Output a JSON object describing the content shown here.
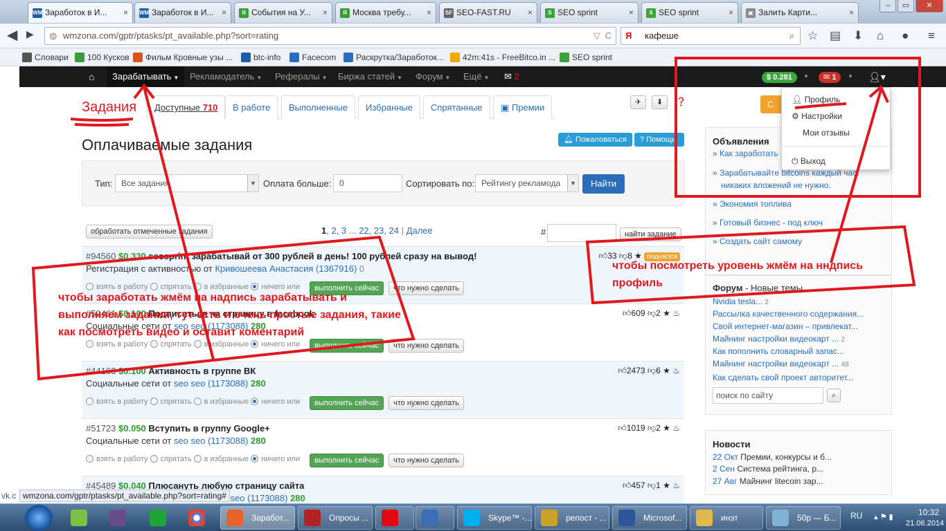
{
  "browser": {
    "tabs": [
      {
        "label": "Заработок в И...",
        "icon_color": "#1f5da6",
        "icon_text": "WM"
      },
      {
        "label": "Заработок в И...",
        "icon_color": "#1f5da6",
        "icon_text": "WM"
      },
      {
        "label": "События на У...",
        "icon_color": "#3a9b3a",
        "icon_text": "ЯЛ"
      },
      {
        "label": "Москва требу...",
        "icon_color": "#3a9b3a",
        "icon_text": "ЯЛ"
      },
      {
        "label": "SEO-FAST.RU",
        "icon_color": "#666",
        "icon_text": "SF"
      },
      {
        "label": "SEO sprint",
        "icon_color": "#3aa33a",
        "icon_text": "S"
      },
      {
        "label": "SEO sprint",
        "icon_color": "#3aa33a",
        "icon_text": "S"
      },
      {
        "label": "Залить Карти...",
        "icon_color": "#8a8a8a",
        "icon_text": "▣"
      }
    ],
    "tab_close": "×",
    "url": "wmzona.com/gptr/ptasks/pt_available.php?sort=rating",
    "search_value": "кафеше",
    "search_engine_icon": "Я",
    "bookmarks": [
      {
        "label": "Словари",
        "icon_color": "#555"
      },
      {
        "label": "100 Кусков",
        "icon_color": "#3a9b3a"
      },
      {
        "label": "Фильм Кровные узы ...",
        "icon_color": "#d9541c"
      },
      {
        "label": "btc-info",
        "icon_color": "#1f5da6"
      },
      {
        "label": "Facecom",
        "icon_color": "#2a6ebb"
      },
      {
        "label": "Раскрутка/Заработок...",
        "icon_color": "#2a6ebb"
      },
      {
        "label": "42m:41s - FreeBitco.in ...",
        "icon_color": "#f2a900"
      },
      {
        "label": "SEO sprint",
        "icon_color": "#3aa33a"
      }
    ]
  },
  "site": {
    "menu": [
      {
        "label": "Зарабатывать"
      },
      {
        "label": "Рекламодатель"
      },
      {
        "label": "Рефералы"
      },
      {
        "label": "Биржа статей"
      },
      {
        "label": "Форум"
      },
      {
        "label": "Ещё"
      }
    ],
    "msg_count": "2",
    "balance": "$ 0.281",
    "mail_count": "1",
    "user_menu": [
      "Профиль",
      "Настройки",
      "Мои отзывы",
      "Выход"
    ]
  },
  "tasks_header": {
    "section_title": "Задания",
    "tab_available": "Доступные",
    "tab_available_count": "710",
    "tabs": [
      "В работе",
      "Выполненные",
      "Избранные",
      "Спрятанные",
      "Премии"
    ],
    "page_title": "Оплачиваемые задания",
    "complain_btn": "Пожаловаться",
    "help_btn": "Помощь",
    "orange_btn": "С"
  },
  "filter": {
    "type_label": "Тип:",
    "type_value": "Все задания",
    "pay_label": "Оплата больше:",
    "pay_value": "0",
    "sort_label": "Сортировать по:",
    "sort_value": "Рейтингу рекламода",
    "find_btn": "Найти"
  },
  "pager": {
    "process_btn": "обработать отмеченные задания",
    "current": "1",
    "pages": ", 2, 3 ... 22, 23, 24",
    "next": "Далее",
    "hash_label": "#",
    "find_task_btn": "найти задание"
  },
  "task_opts": {
    "take": "взять в работу",
    "hide": "спрятать",
    "fav": "в избранные",
    "none": "ничего или",
    "do_now": "выполнить сейчас",
    "what": "что нужно сделать"
  },
  "tasks": [
    {
      "id": "#94560",
      "price": "$0.330",
      "title": "seosprint зарабатывай от 300 рублей в день! 100 рублей сразу на вывод!",
      "category": "Регистрация с активностью от",
      "author": "Кривошеева Анастасия (1367916)",
      "author_count": "0",
      "likes": "33",
      "dislikes": "8",
      "badge": "поднялся"
    },
    {
      "id": "#59461",
      "price": "$0.100",
      "title": "Подписаться на страницу в facebook",
      "category": "Социальные сети от",
      "author": "seo seo (1173088)",
      "author_count": "280",
      "likes": "609",
      "dislikes": "2",
      "badge": ""
    },
    {
      "id": "#44163",
      "price": "$0.100",
      "title": "Активность в группе ВК",
      "category": "Социальные сети от",
      "author": "seo seo (1173088)",
      "author_count": "280",
      "likes": "2473",
      "dislikes": "6",
      "badge": ""
    },
    {
      "id": "#51723",
      "price": "$0.050",
      "title": "Вступить в группу Google+",
      "category": "Социальные сети от",
      "author": "seo seo (1173088)",
      "author_count": "280",
      "likes": "1019",
      "dislikes": "2",
      "badge": ""
    },
    {
      "id": "#45489",
      "price": "$0.040",
      "title": "Плюсануть любую страницу сайта",
      "category": "",
      "author": "seo seo (1173088)",
      "author_count": "280",
      "likes": "457",
      "dislikes": "1",
      "badge": ""
    }
  ],
  "sidebar": {
    "ads_title": "Объявления",
    "ads": [
      "» Как заработать",
      "» Зарабатывайте bitcoins каждый час.",
      "никаких вложений не нужно.",
      "» Экономия топлива",
      "» Готовый бизнес - под ключ",
      "» Создать сайт самому"
    ],
    "forum_title": "Форум",
    "forum_subtitle": " - Новые темы",
    "forum_items": [
      {
        "label": "Nvidia tesla...",
        "count": "2"
      },
      {
        "label": "Рассылка качественного содержания...",
        "count": ""
      },
      {
        "label": "Свой интернет-магазин – привлекат...",
        "count": ""
      },
      {
        "label": "Майнинг настройки видеокарт ...",
        "count": "2"
      },
      {
        "label": "Как пополнить словарный запас...",
        "count": ""
      },
      {
        "label": "Майнинг настройки видеокарт ...",
        "count": "48"
      },
      {
        "label": "Как сделать свой проект авторитет...",
        "count": ""
      }
    ],
    "site_search_placeholder": "поиск по сайту",
    "news_title": "Новости",
    "news": [
      {
        "date": "22 Окт",
        "text": "Премии, конкурсы и б..."
      },
      {
        "date": "2 Сен",
        "text": "Система рейтинга, р..."
      },
      {
        "date": "27 Авг",
        "text": "Майнинг litecoin зар..."
      }
    ]
  },
  "annotations": {
    "left": "чтобы заработать жмём на надпись зарабатывать и выполняем задания, тут есть и очень простые задания, такие как посмотреть видео и оставит коментарий",
    "right": "чтобы посмотреть уровень жмём на нндпись профиль"
  },
  "status_url": "wmzona.com/gptr/ptasks/pt_available.php?sort=rating#",
  "status_left": "vk.c",
  "taskbar": {
    "items": [
      {
        "label": "Заработ...",
        "color": "#e8632b"
      },
      {
        "label": "Опросы ...",
        "color": "#b22222"
      },
      {
        "label": "",
        "color": "#e30613"
      },
      {
        "label": "",
        "color": "#3a6fb5"
      },
      {
        "label": "Skype™ -...",
        "color": "#00aff0"
      },
      {
        "label": "репост - ...",
        "color": "#c9a227"
      },
      {
        "label": "Microsof...",
        "color": "#2b579a"
      },
      {
        "label": "инэт",
        "color": "#e3b84a"
      },
      {
        "label": "50р — Б...",
        "color": "#7fb3d5"
      }
    ],
    "lang": "RU",
    "time": "10:32",
    "date": "21.06.2014"
  }
}
